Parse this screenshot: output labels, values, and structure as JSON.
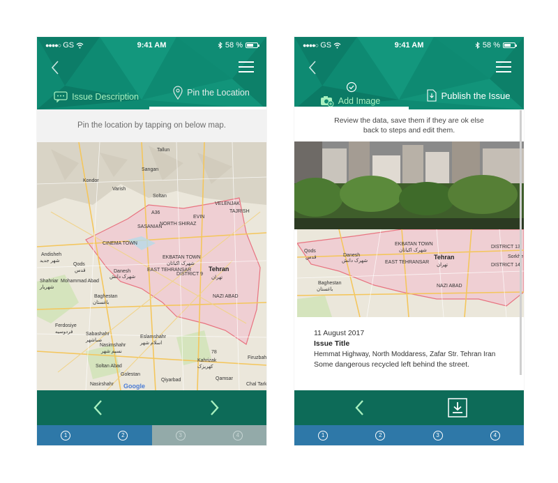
{
  "status": {
    "carrier": "GS",
    "time": "9:41 AM",
    "battery": "58 %",
    "battery_level": 0.58
  },
  "left": {
    "tabs": [
      {
        "label": "Issue Description"
      },
      {
        "label": "Pin the Location"
      }
    ],
    "instruction": "Pin the location by tapping on below map.",
    "steps": [
      "1",
      "2",
      "3",
      "4"
    ]
  },
  "right": {
    "tabs": [
      {
        "label": "Add Image"
      },
      {
        "label": "Publish the Issue"
      }
    ],
    "instruction_line1": "Review the data, save them if they are ok else",
    "instruction_line2": "back to steps and edit them.",
    "issue": {
      "date": "11 August 2017",
      "title": "Issue Title",
      "address": "Hemmat Highway, North Moddaress, Zafar Str. Tehran Iran",
      "description": "Some dangerous recycled left behind the street."
    },
    "steps": [
      "1",
      "2",
      "3",
      "4"
    ]
  },
  "map_labels": {
    "tehran": "Tehran",
    "tehran_fa": "تهران",
    "qods": "Qods",
    "qods_fa": "قدس",
    "shahriar": "Shahriar",
    "shahriar_fa": "شهریار",
    "baghestan": "Baghestan",
    "baghestan_fa": "باغستان",
    "andisheh": "Andisheh",
    "andisheh_fa": "شهر جدید",
    "mohammad_abad": "Mohammad Abad",
    "sabashahr": "Sabashahr",
    "sabashahr_fa": "صباشهر",
    "nasimshahr": "Nasimshahr",
    "nasimshahr_fa": "نسیم شهر",
    "eslamshahr": "Eslamshahr",
    "eslamshahr_fa": "اسلام شهر",
    "soltan_abad": "Soltan Abad",
    "ferdosiye": "Ferdosiye",
    "ferdosiye_fa": "فردوسیه",
    "golestan": "Golestan",
    "nasirshahr": "Nasirshahr",
    "danesh": "Danesh",
    "danesh_fa": "شهرک دانش",
    "ekbatan": "EKBATAN TOWN",
    "ekbatan_fa": "شهرک اکباتان",
    "cinema": "CINEMA TOWN",
    "district9": "DISTRICT 9",
    "district13": "DISTRICT 13",
    "district14": "DISTRICT 14",
    "nazi_abad": "NAZI ABAD",
    "kahrizak": "Kahrizak",
    "kahrizak_fa": "کهریزک",
    "qamsar": "Qamsar",
    "qiyarbad": "Qiyarbad",
    "firuzbahram": "Firuzbahram",
    "chal_tarkhan": "Chal Tarkhan",
    "tallun": "Tallun",
    "varish": "Varish",
    "kondor": "Kondor",
    "sangan": "Sangan",
    "soltan": "Soltan",
    "velenjak": "VELENJAK",
    "tajrish": "TAJRISH",
    "evin": "EVIN",
    "sasanian": "SASANIAN",
    "north_shiraz": "NORTH SHIRAZ",
    "east_tehransar": "EAST TEHRANSAR",
    "google": "Google",
    "road_a36": "A36",
    "road_78": "78",
    "sorkhe": "Sorkhe"
  }
}
